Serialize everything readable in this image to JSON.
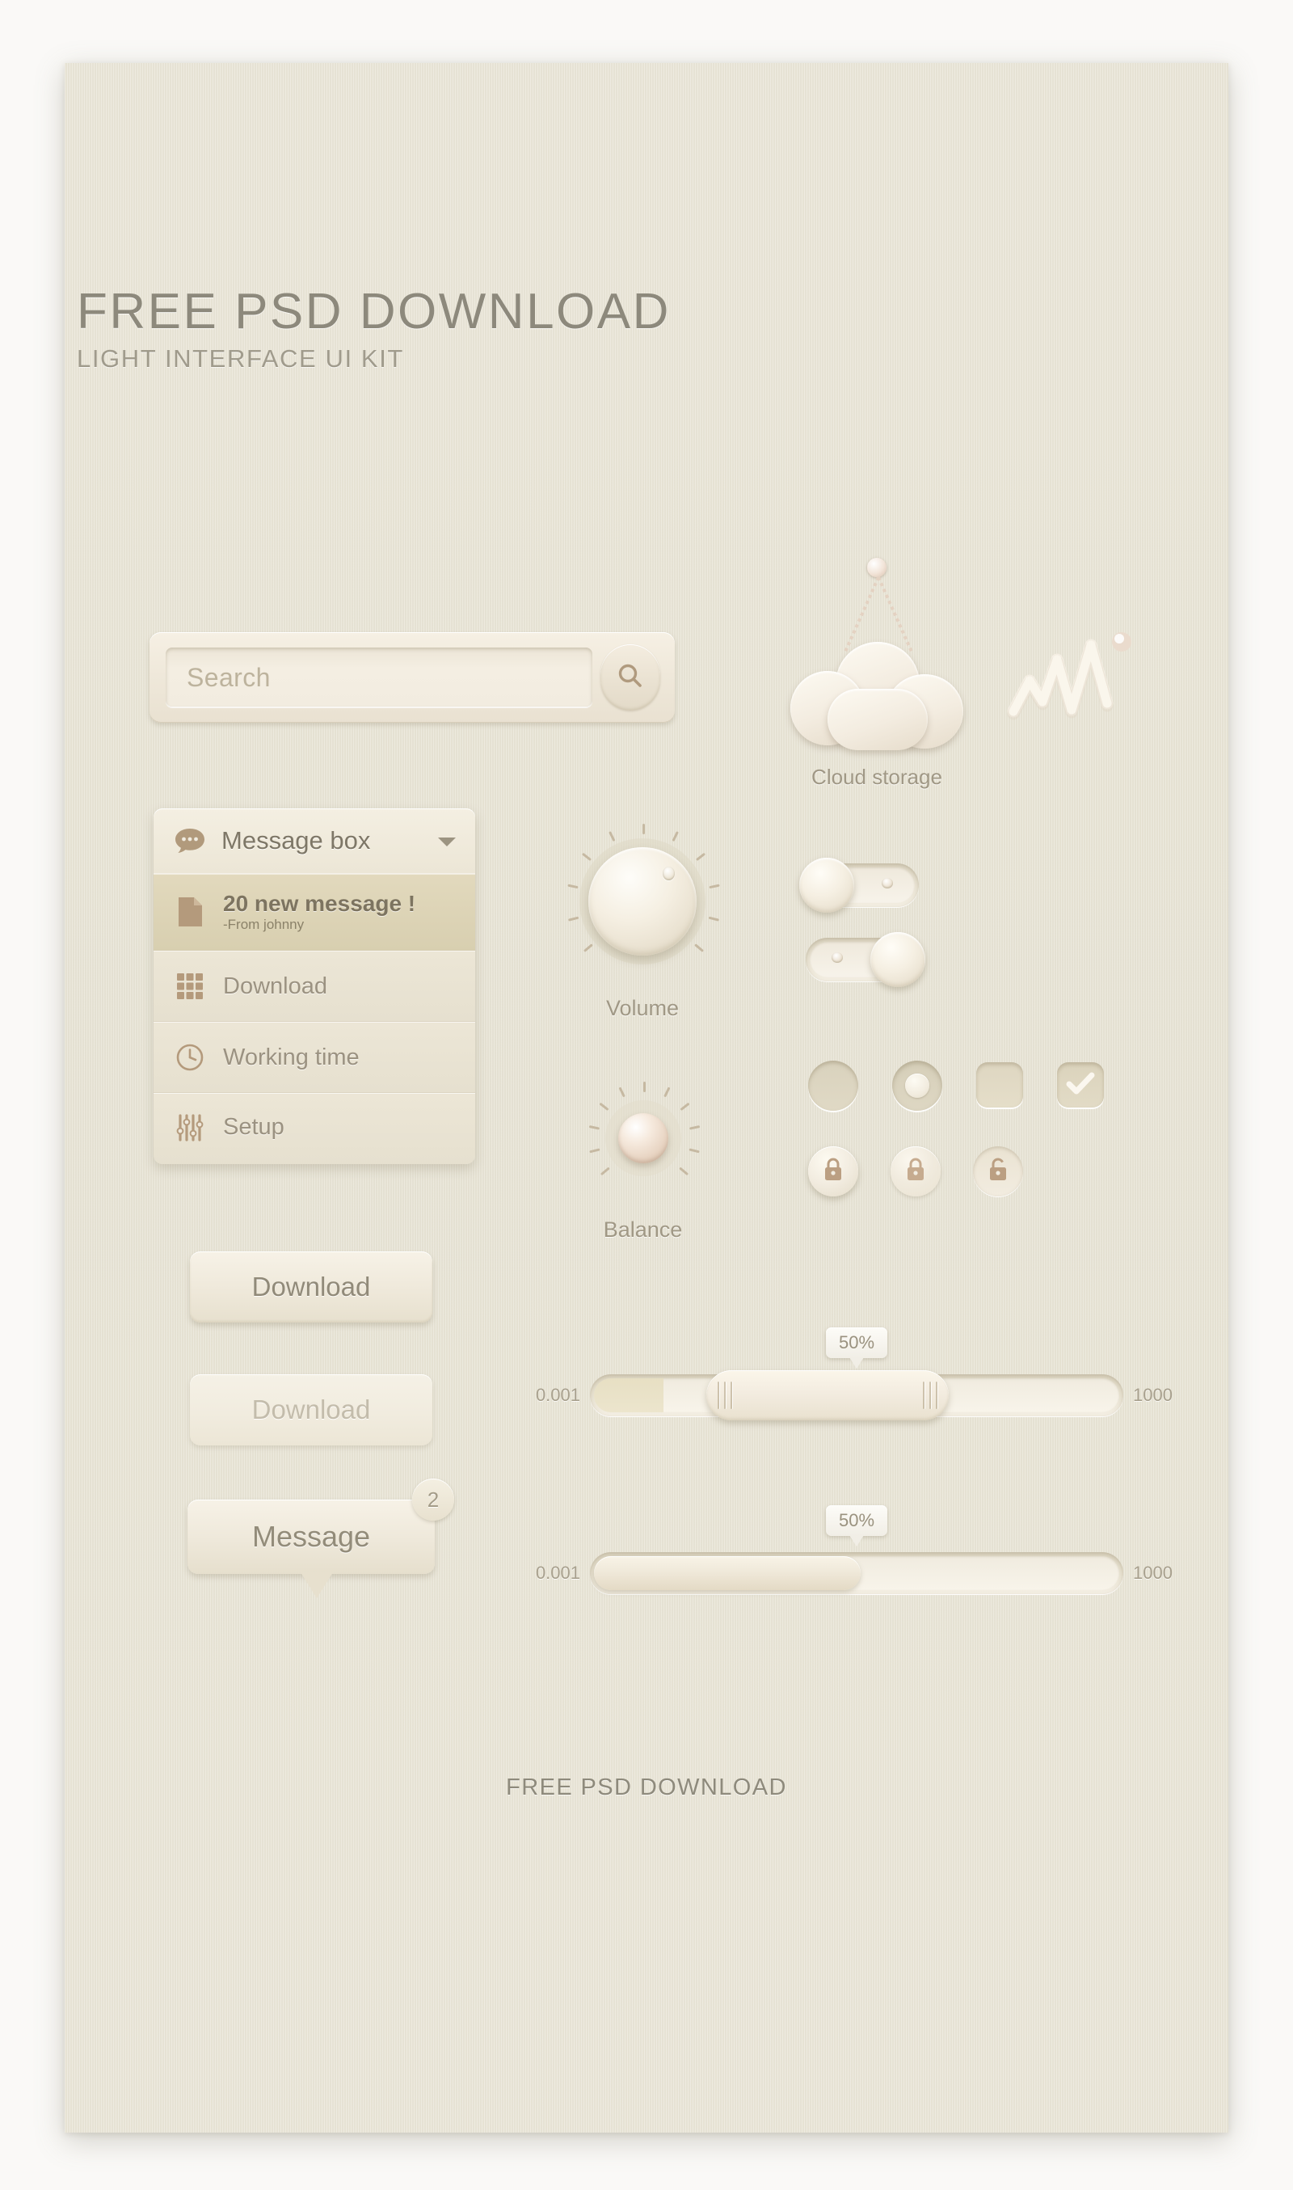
{
  "theme": {
    "canvas_bg": "#e8e4d6",
    "page_bg": "#faf9f7",
    "accent": "#b09a7e",
    "text_dark": "#8d897c",
    "text_muted": "#a09b8c",
    "highlight_row": "#dcd3b5"
  },
  "header": {
    "title": "FREE PSD DOWNLOAD",
    "subtitle": "LIGHT INTERFACE UI KIT"
  },
  "footer": {
    "text": "FREE PSD DOWNLOAD"
  },
  "search": {
    "placeholder": "Search",
    "value": "",
    "button_icon": "search-icon"
  },
  "message_menu": {
    "header": {
      "label": "Message box",
      "icon": "chat-bubble-icon",
      "caret": "▼"
    },
    "items": [
      {
        "label": "20 new message !",
        "sub": "-From johnny",
        "icon": "document-icon",
        "highlighted": true
      },
      {
        "label": "Download",
        "sub": "",
        "icon": "grid-icon",
        "highlighted": false
      },
      {
        "label": "Working time",
        "sub": "",
        "icon": "clock-icon",
        "highlighted": false
      },
      {
        "label": "Setup",
        "sub": "",
        "icon": "sliders-icon",
        "highlighted": false
      }
    ]
  },
  "buttons": {
    "download_primary": "Download",
    "download_disabled": "Download",
    "message": "Message",
    "message_badge": "2"
  },
  "knobs": [
    {
      "name": "volume",
      "label": "Volume",
      "ticks": 11
    },
    {
      "name": "balance",
      "label": "Balance",
      "ticks": 11
    }
  ],
  "cloud": {
    "label": "Cloud storage",
    "icon": "cloud-icon"
  },
  "waveform": {
    "icon": "waveform-icon"
  },
  "toggles": [
    {
      "name": "toggle-off",
      "state": "off"
    },
    {
      "name": "toggle-on",
      "state": "on"
    }
  ],
  "controls": [
    {
      "name": "radio-unchecked",
      "type": "radio",
      "checked": false
    },
    {
      "name": "radio-checked",
      "type": "radio",
      "checked": true
    },
    {
      "name": "checkbox-empty",
      "type": "checkbox",
      "checked": false
    },
    {
      "name": "checkbox-checked",
      "type": "checkbox",
      "checked": true
    }
  ],
  "locks": [
    {
      "name": "lock-raised",
      "icon": "lock-closed-icon",
      "style": "raised"
    },
    {
      "name": "lock-flat",
      "icon": "lock-closed-icon",
      "style": "flat"
    },
    {
      "name": "lock-unlocked",
      "icon": "lock-open-icon",
      "style": "inset"
    }
  ],
  "sliders": [
    {
      "name": "range-slider",
      "min_label": "0.001",
      "max_label": "1000",
      "tooltip": "50%",
      "value_percent": 50,
      "style": "range-handle"
    },
    {
      "name": "progress-slider",
      "min_label": "0.001",
      "max_label": "1000",
      "tooltip": "50%",
      "value_percent": 50,
      "style": "fill-bar"
    }
  ]
}
